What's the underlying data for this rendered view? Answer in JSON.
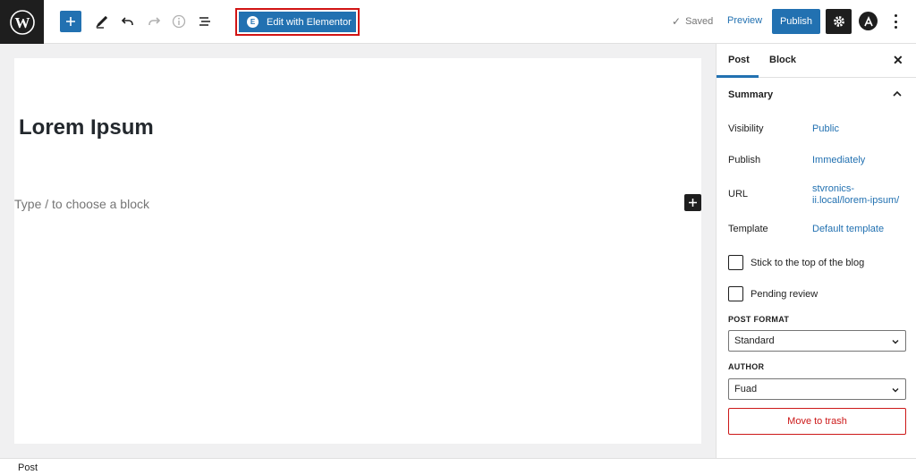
{
  "toolbar": {
    "add_icon": "plus-icon",
    "elementor_badge": "E",
    "elementor_label": "Edit with Elementor",
    "saved_label": "Saved",
    "preview_label": "Preview",
    "publish_label": "Publish"
  },
  "editor": {
    "title": "Lorem Ipsum",
    "placeholder": "Type / to choose a block"
  },
  "sidebar": {
    "tabs": [
      "Post",
      "Block"
    ],
    "summary_label": "Summary",
    "rows": [
      {
        "label": "Visibility",
        "value": "Public"
      },
      {
        "label": "Publish",
        "value": "Immediately"
      },
      {
        "label": "URL",
        "value_line1": "stvronics-",
        "value_line2": "ii.local/lorem-ipsum/"
      },
      {
        "label": "Template",
        "value": "Default template"
      }
    ],
    "checkboxes": [
      "Stick to the top of the blog",
      "Pending review"
    ],
    "post_format_label": "POST FORMAT",
    "post_format_value": "Standard",
    "author_label": "AUTHOR",
    "author_value": "Fuad",
    "trash_label": "Move to trash"
  },
  "footer": {
    "label": "Post"
  },
  "colors": {
    "accent": "#2271b1",
    "danger": "#cc1818",
    "dark": "#1e1e1e",
    "highlight": "#d11414"
  }
}
